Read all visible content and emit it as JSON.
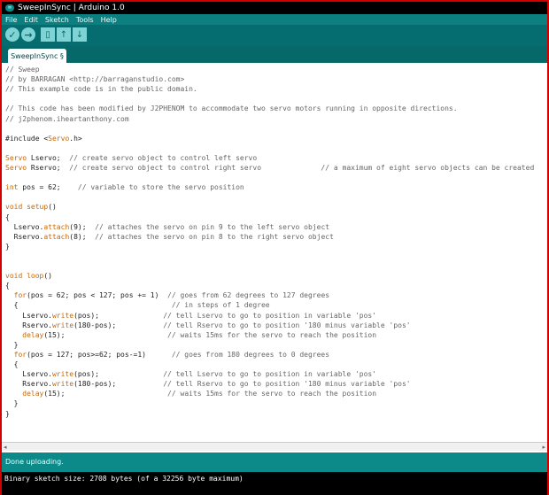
{
  "window": {
    "title": "SweepInSync | Arduino 1.0"
  },
  "menubar": [
    "File",
    "Edit",
    "Sketch",
    "Tools",
    "Help"
  ],
  "toolbar": {
    "buttons": [
      {
        "name": "verify",
        "icon": "checkmark-icon"
      },
      {
        "name": "upload",
        "icon": "right-arrow-icon"
      },
      {
        "name": "new",
        "icon": "new-file-icon"
      },
      {
        "name": "open",
        "icon": "up-arrow-icon"
      },
      {
        "name": "save",
        "icon": "down-arrow-icon"
      }
    ]
  },
  "tab": {
    "label": "SweepInSync §"
  },
  "code": {
    "lines": [
      "// Sweep",
      "// by BARRAGAN <http://barraganstudio.com>",
      "// This example code is in the public domain.",
      "",
      "// This code has been modified by J2PHENOM to accommodate two servo motors running in opposite directions.",
      "// j2phenom.iheartanthony.com",
      "",
      "#include <Servo.h>",
      "",
      "Servo Lservo;  // create servo object to control left servo",
      "Servo Rservo;  // create servo object to control right servo              // a maximum of eight servo objects can be created",
      "",
      "int pos = 62;    // variable to store the servo position",
      "",
      "void setup()",
      "{",
      "  Lservo.attach(9);  // attaches the servo on pin 9 to the left servo object",
      "  Rservo.attach(8);  // attaches the servo on pin 8 to the right servo object",
      "}",
      "",
      "",
      "void loop()",
      "{",
      "  for(pos = 62; pos < 127; pos += 1)  // goes from 62 degrees to 127 degrees",
      "  {                                    // in steps of 1 degree",
      "    Lservo.write(pos);               // tell Lservo to go to position in variable 'pos'",
      "    Rservo.write(180-pos);           // tell Rservo to go to position '180 minus variable 'pos'",
      "    delay(15);                        // waits 15ms for the servo to reach the position",
      "  }",
      "  for(pos = 127; pos>=62; pos-=1)      // goes from 180 degrees to 0 degrees",
      "  {",
      "    Lservo.write(pos);               // tell Lservo to go to position in variable 'pos'",
      "    Rservo.write(180-pos);           // tell Rservo to go to position '180 minus variable 'pos'",
      "    delay(15);                        // waits 15ms for the servo to reach the position",
      "  }",
      "}"
    ]
  },
  "status": {
    "message": "Done uploading."
  },
  "console": {
    "text": "Binary sketch size: 2708 bytes (of a 32256 byte maximum)"
  },
  "colors": {
    "accent": "#0c8a8a",
    "toolbar": "#056d6f",
    "keyword": "#cc6600",
    "comment": "#666666"
  }
}
